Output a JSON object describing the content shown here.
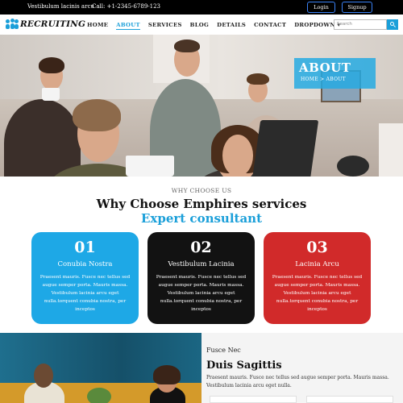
{
  "topbar": {
    "address": "Vestibulum lacinis arcu",
    "call": "Call: +1-2345-6789-123",
    "login_label": "Login",
    "signup_label": "Signup",
    "accent": "#3b82f6"
  },
  "nav": {
    "logo_text": "RECRUITING",
    "items": [
      {
        "label": "HOME",
        "active": false
      },
      {
        "label": "ABOUT",
        "active": true
      },
      {
        "label": "SERVICES",
        "active": false
      },
      {
        "label": "BLOG",
        "active": false
      },
      {
        "label": "DETAILS",
        "active": false
      },
      {
        "label": "CONTACT",
        "active": false
      },
      {
        "label": "DROPDOWN ▾",
        "active": false
      }
    ],
    "search_placeholder": "Search",
    "accent": "#1a9fd9"
  },
  "hero": {
    "title": "ABOUT",
    "crumb": "HOME > ABOUT"
  },
  "why": {
    "kicker": "WHY CHOOSE US",
    "title": "Why Choose Emphires services",
    "subtitle": "Expert consultant"
  },
  "cards": [
    {
      "num": "01",
      "title": "Conubia Nostra",
      "body": "Praesent mauris. Fusce nec tellus sed augue semper porta. Mauris massa. Vestibulum lacinia arcu eget nulla.torquent conubia nostra, per inceptos",
      "color": "#1ea8e6"
    },
    {
      "num": "02",
      "title": "Vestibulum Lacinia",
      "body": "Praesent mauris. Fusce nec tellus sed augue semper porta. Mauris massa. Vestibulum lacinia arcu eget nulla.torquent conubia nostra, per inceptos",
      "color": "#121212"
    },
    {
      "num": "03",
      "title": "Lacinia Arcu",
      "body": "Praesent mauris. Fusce nec tellus sed augue semper porta. Mauris massa. Vestibulum lacinia arcu eget nulla.torquent conubia nostra, per inceptos",
      "color": "#d12a2a"
    }
  ],
  "bottom": {
    "kicker": "Fusce Nec",
    "title": "Duis Sagittis",
    "text": "Praesent mauris. Fusce nec tellus sed augue semper porta. Mauris massa. Vestibulum lacinia arcu eget nulla."
  }
}
